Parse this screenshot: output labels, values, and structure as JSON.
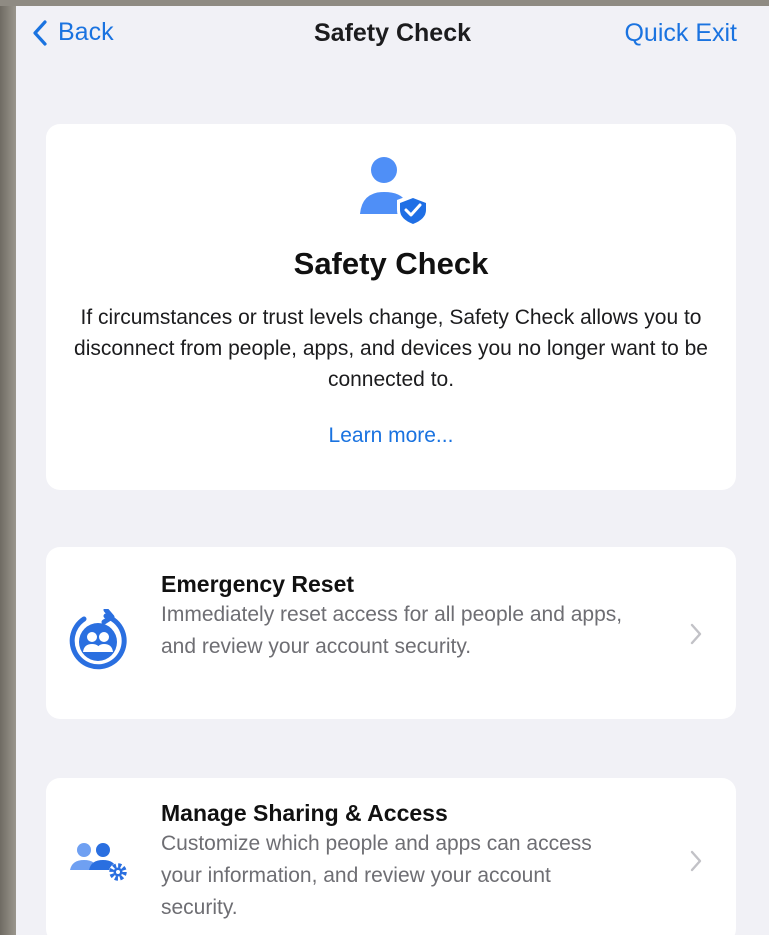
{
  "nav": {
    "back_label": "Back",
    "title": "Safety Check",
    "quick_exit_label": "Quick Exit"
  },
  "hero": {
    "icon": "person-shield-icon",
    "title": "Safety Check",
    "body": "If circumstances or trust levels change, Safety Check allows you to disconnect from people, apps, and devices you no longer want to be connected to.",
    "learn_more": "Learn more..."
  },
  "options": [
    {
      "icon": "emergency-reset-icon",
      "title": "Emergency Reset",
      "description": "Immediately reset access for all people and apps, and review your account security."
    },
    {
      "icon": "people-gear-icon",
      "title": "Manage Sharing & Access",
      "description": "Customize which people and apps can access your information, and review your account security."
    }
  ],
  "colors": {
    "accent": "#1a73e0",
    "background": "#f1f1f6",
    "card": "#ffffff",
    "icon_blue": "#3478f6"
  }
}
